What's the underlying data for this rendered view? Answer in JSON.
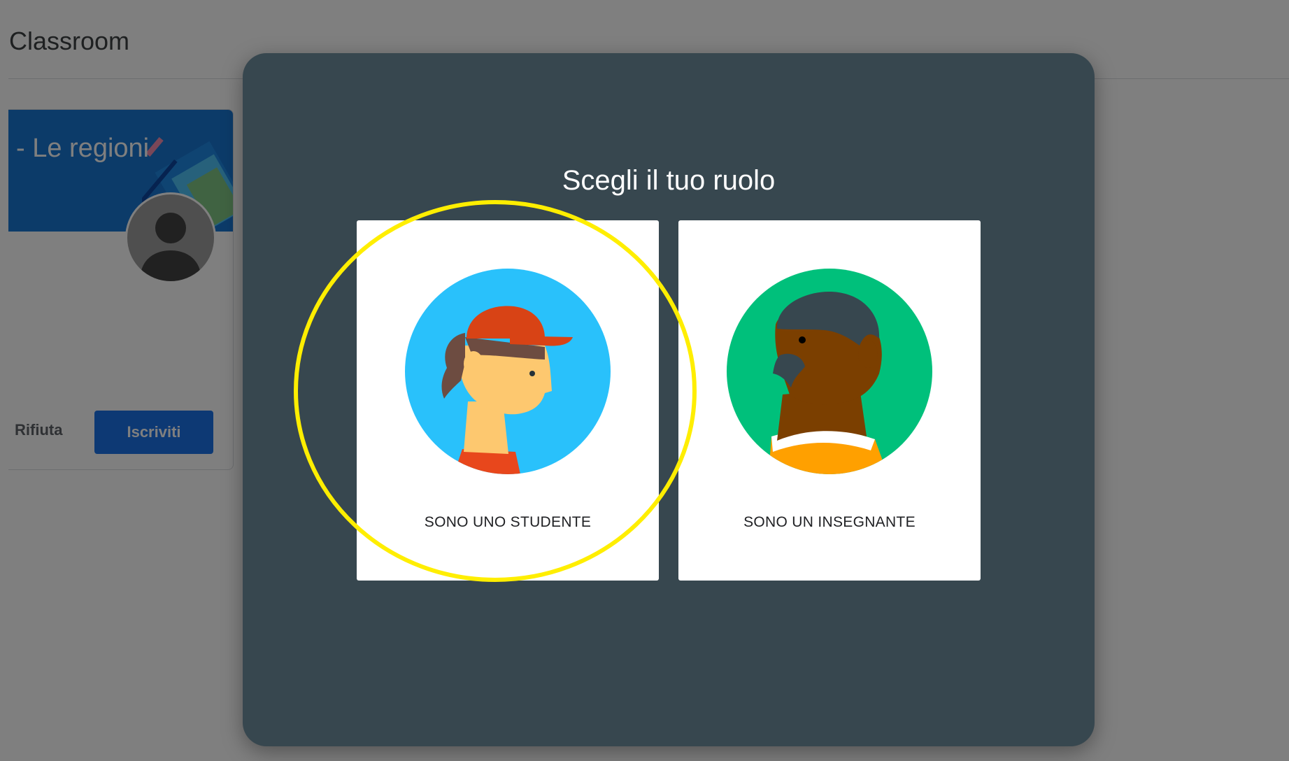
{
  "app": {
    "title": "Classroom",
    "class_card": {
      "name": "- Le regioni",
      "decline_label": "Rifiuta",
      "join_label": "Iscriviti"
    }
  },
  "dialog": {
    "title": "Scegli il tuo ruolo",
    "roles": [
      {
        "label": "SONO UNO STUDENTE",
        "icon": "student-illustration-icon",
        "color": "#29c1fb"
      },
      {
        "label": "SONO UN INSEGNANTE",
        "icon": "teacher-illustration-icon",
        "color": "#00c07b"
      }
    ]
  },
  "colors": {
    "dialog_bg": "#37474f",
    "join_button": "#1a73e8",
    "highlight": "#ffee00"
  }
}
